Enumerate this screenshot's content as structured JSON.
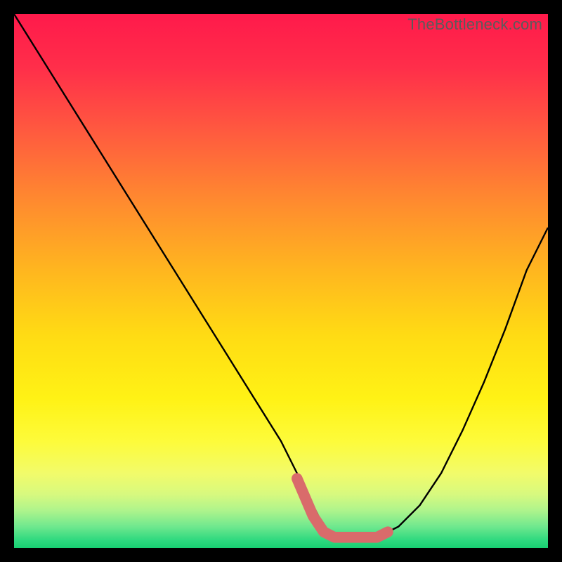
{
  "watermark_text": "TheBottleneck.com",
  "chart_data": {
    "type": "line",
    "title": "",
    "xlabel": "",
    "ylabel": "",
    "xlim": [
      0,
      100
    ],
    "ylim": [
      0,
      100
    ],
    "series": [
      {
        "name": "curve",
        "color": "#000000",
        "x": [
          0,
          5,
          10,
          15,
          20,
          25,
          30,
          35,
          40,
          45,
          50,
          53,
          56,
          58,
          60,
          62,
          65,
          68,
          72,
          76,
          80,
          84,
          88,
          92,
          96,
          100
        ],
        "y": [
          100,
          92,
          84,
          76,
          68,
          60,
          52,
          44,
          36,
          28,
          20,
          14,
          8,
          4,
          2,
          2,
          2,
          2,
          4,
          8,
          14,
          22,
          31,
          41,
          52,
          60
        ]
      },
      {
        "name": "sweet-spot",
        "color": "#d96b6b",
        "stroke_width": 12,
        "x": [
          53,
          56,
          58,
          60,
          62,
          65,
          68,
          70
        ],
        "y": [
          13,
          6,
          3,
          2,
          2,
          2,
          2,
          3
        ]
      }
    ],
    "background_gradient": {
      "stops": [
        {
          "offset": 0.0,
          "color": "#ff1a4b"
        },
        {
          "offset": 0.1,
          "color": "#ff2e4a"
        },
        {
          "offset": 0.22,
          "color": "#ff5a3f"
        },
        {
          "offset": 0.35,
          "color": "#ff8a2f"
        },
        {
          "offset": 0.48,
          "color": "#ffb61f"
        },
        {
          "offset": 0.6,
          "color": "#ffdb14"
        },
        {
          "offset": 0.72,
          "color": "#fff215"
        },
        {
          "offset": 0.8,
          "color": "#fdfb3a"
        },
        {
          "offset": 0.86,
          "color": "#f2fb6a"
        },
        {
          "offset": 0.9,
          "color": "#d7f97f"
        },
        {
          "offset": 0.93,
          "color": "#aef48c"
        },
        {
          "offset": 0.96,
          "color": "#6fe88e"
        },
        {
          "offset": 0.985,
          "color": "#2fd97f"
        },
        {
          "offset": 1.0,
          "color": "#18cf72"
        }
      ]
    }
  }
}
